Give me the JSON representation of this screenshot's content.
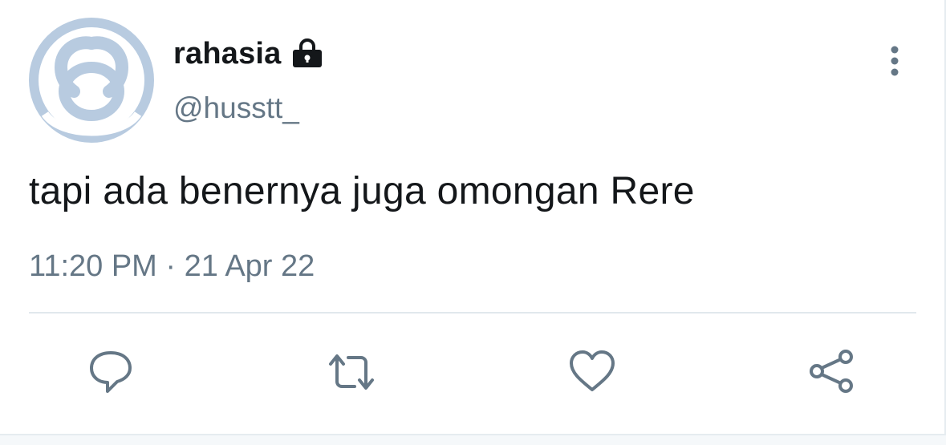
{
  "tweet": {
    "display_name": "rahasia",
    "handle": "@husstt_",
    "text": "tapi ada benernya juga omongan Rere",
    "timestamp": "11:20 PM · 21 Apr 22",
    "protected": true
  },
  "icons": {
    "avatar": "default-avatar-icon",
    "lock": "lock-icon",
    "more": "more-vertical-icon",
    "reply": "reply-icon",
    "retweet": "retweet-icon",
    "like": "heart-icon",
    "share": "share-icon"
  },
  "colors": {
    "text_primary": "#14171a",
    "text_secondary": "#657786",
    "icon": "#657786",
    "avatar": "#b8cbe0",
    "divider": "#e1e8ed"
  }
}
